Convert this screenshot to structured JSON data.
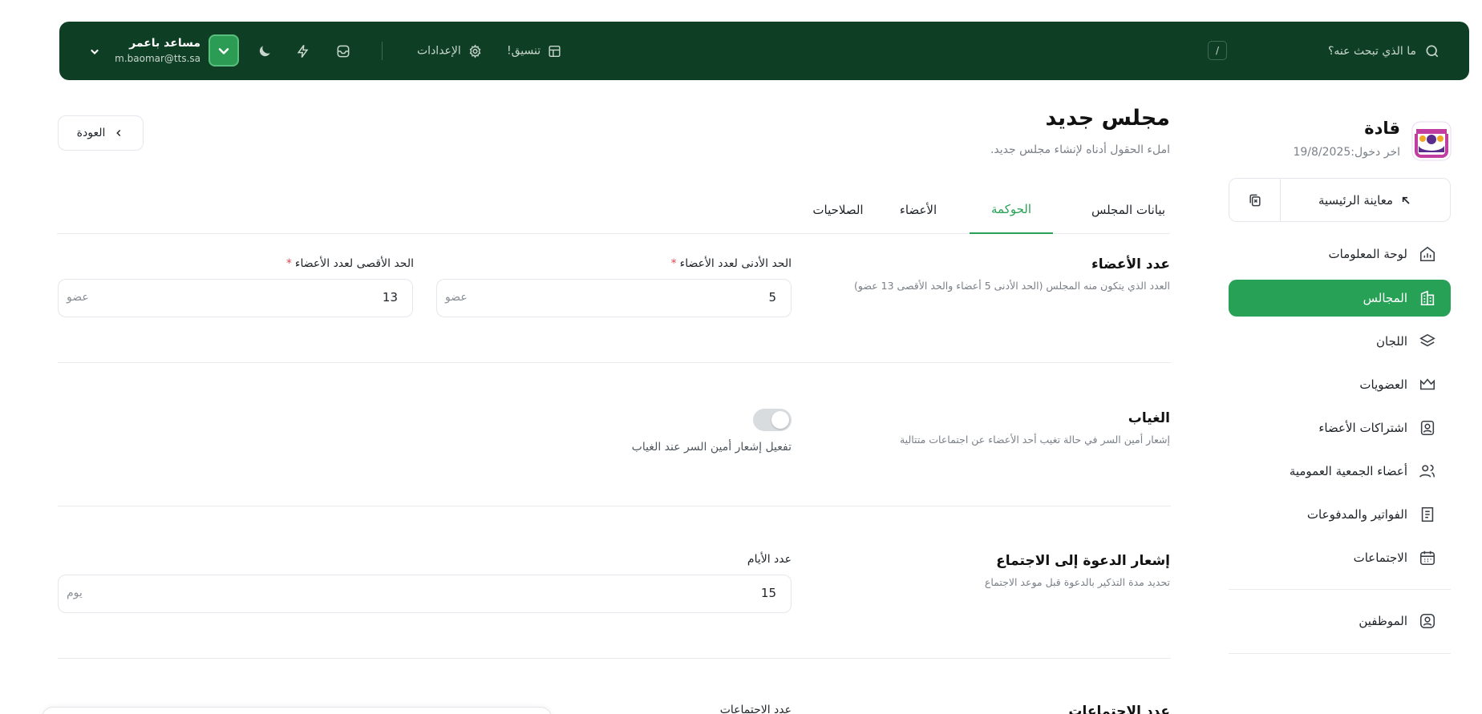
{
  "topbar": {
    "search_placeholder": "ما الذي تبحث عنه؟",
    "shortcut_key": "/",
    "format_label": "تنسيق!",
    "settings_label": "الإعدادات",
    "user_name": "مساعد باعمر",
    "user_email": "m.baomar@tts.sa",
    "icons": [
      "search-icon",
      "layout-icon",
      "gear-icon",
      "inbox-icon",
      "bolt-icon",
      "moon-icon",
      "check-icon",
      "chevron-down-icon"
    ]
  },
  "sidebar": {
    "brand_name": "قادة",
    "last_login": "اخر دخول:19/8/2025",
    "preview_label": "معاينة الرئيسية",
    "items": [
      {
        "label": "لوحة المعلومات",
        "icon": "chart-home-icon"
      },
      {
        "label": "المجالس",
        "icon": "building-icon",
        "active": true
      },
      {
        "label": "اللجان",
        "icon": "layers-icon"
      },
      {
        "label": "العضويات",
        "icon": "crown-icon"
      },
      {
        "label": "اشتراكات الأعضاء",
        "icon": "user-badge-icon"
      },
      {
        "label": "أعضاء الجمعية العمومية",
        "icon": "users-icon"
      },
      {
        "label": "الفواتير والمدفوعات",
        "icon": "receipt-icon"
      },
      {
        "label": "الاجتماعات",
        "icon": "calendar-icon"
      },
      {
        "label": "الموظفين",
        "icon": "employee-icon"
      }
    ]
  },
  "page": {
    "title": "مجلس جديد",
    "subtitle": "املء الحقول أدناه لإنشاء مجلس جديد.",
    "back_label": "العودة"
  },
  "tabs": [
    {
      "label": "بيانات المجلس"
    },
    {
      "label": "الحوكمة",
      "active": true
    },
    {
      "label": "الأعضاء"
    },
    {
      "label": "الصلاحيات"
    }
  ],
  "sections": {
    "members": {
      "title": "عدد الأعضاء",
      "desc": "العدد الذي يتكون منه المجلس (الحد الأدنى 5 أعضاء والحد الأقصى 13 عضو)",
      "min_label": "الحد الأدنى لعدد الأعضاء",
      "min_value": "5",
      "max_label": "الحد الأقصى لعدد الأعضاء",
      "max_value": "13",
      "unit": "عضو",
      "required_mark": "*"
    },
    "absence": {
      "title": "الغياب",
      "desc": "إشعار أمين السر في حالة تغيب أحد الأعضاء عن اجتماعات متتالية",
      "toggle_label": "تفعيل إشعار أمين السر عند الغياب",
      "toggle_on": false
    },
    "invite": {
      "title": "إشعار الدعوة إلى الاجتماع",
      "desc": "تحديد مدة التذكير بالدعوة قبل موعد الاجتماع",
      "days_label": "عدد الأيام",
      "days_value": "15",
      "unit": "يوم"
    },
    "meetings": {
      "title": "عدد الاجتماعات",
      "field_label": "عدد الاجتماعات"
    }
  },
  "colors": {
    "topbar_bg": "#0e3f24",
    "accent": "#27a155",
    "required": "#e5484d"
  }
}
